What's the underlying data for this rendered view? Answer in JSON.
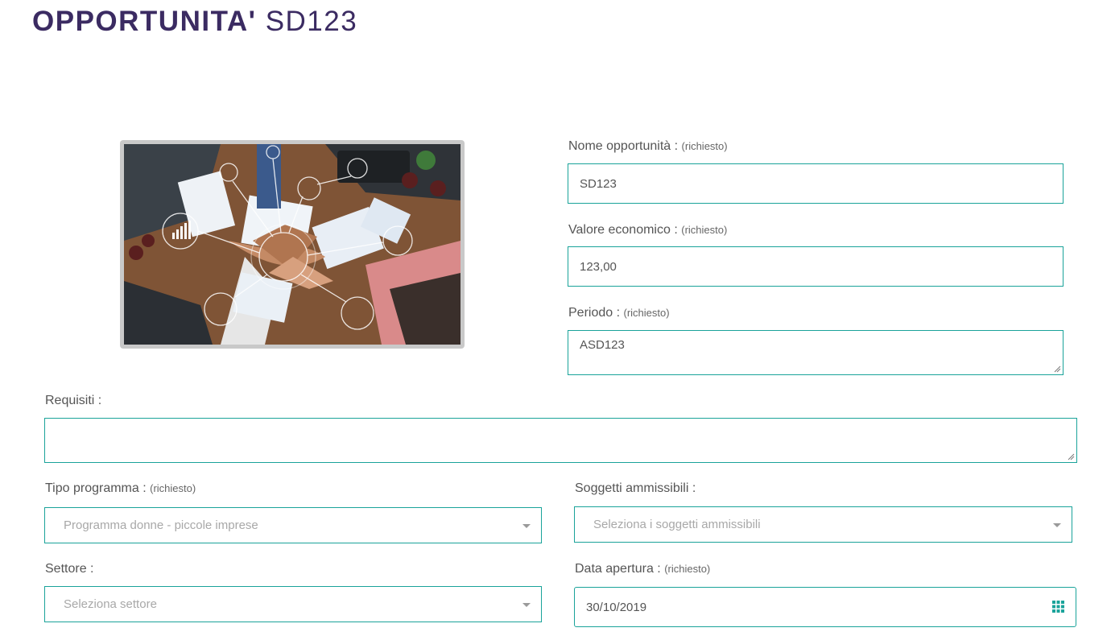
{
  "header": {
    "title_bold": "OPPORTUNITA'",
    "title_code": "SD123"
  },
  "form": {
    "nome": {
      "label": "Nome opportunità :",
      "required": "(richiesto)",
      "value": "SD123"
    },
    "valore": {
      "label": "Valore economico :",
      "required": "(richiesto)",
      "value": "123,00"
    },
    "periodo": {
      "label": "Periodo :",
      "required": "(richiesto)",
      "value": "ASD123"
    },
    "requisiti": {
      "label": "Requisiti :",
      "value": ""
    },
    "tipo_programma": {
      "label": "Tipo programma :",
      "required": "(richiesto)",
      "selected": "Programma donne - piccole imprese"
    },
    "soggetti": {
      "label": "Soggetti ammissibili :",
      "placeholder": "Seleziona i soggetti ammissibili"
    },
    "settore": {
      "label": "Settore :",
      "placeholder": "Seleziona settore"
    },
    "data_apertura": {
      "label": "Data apertura :",
      "required": "(richiesto)",
      "value": "30/10/2019"
    }
  },
  "icons": {
    "select_arrow": "chevron-down-icon",
    "datepicker": "calendar-grid-icon",
    "resize": "resize-grip-icon"
  },
  "colors": {
    "accent_border": "#1aa39a",
    "title": "#3b2b62",
    "calendar_icon": "#1aa39a"
  }
}
